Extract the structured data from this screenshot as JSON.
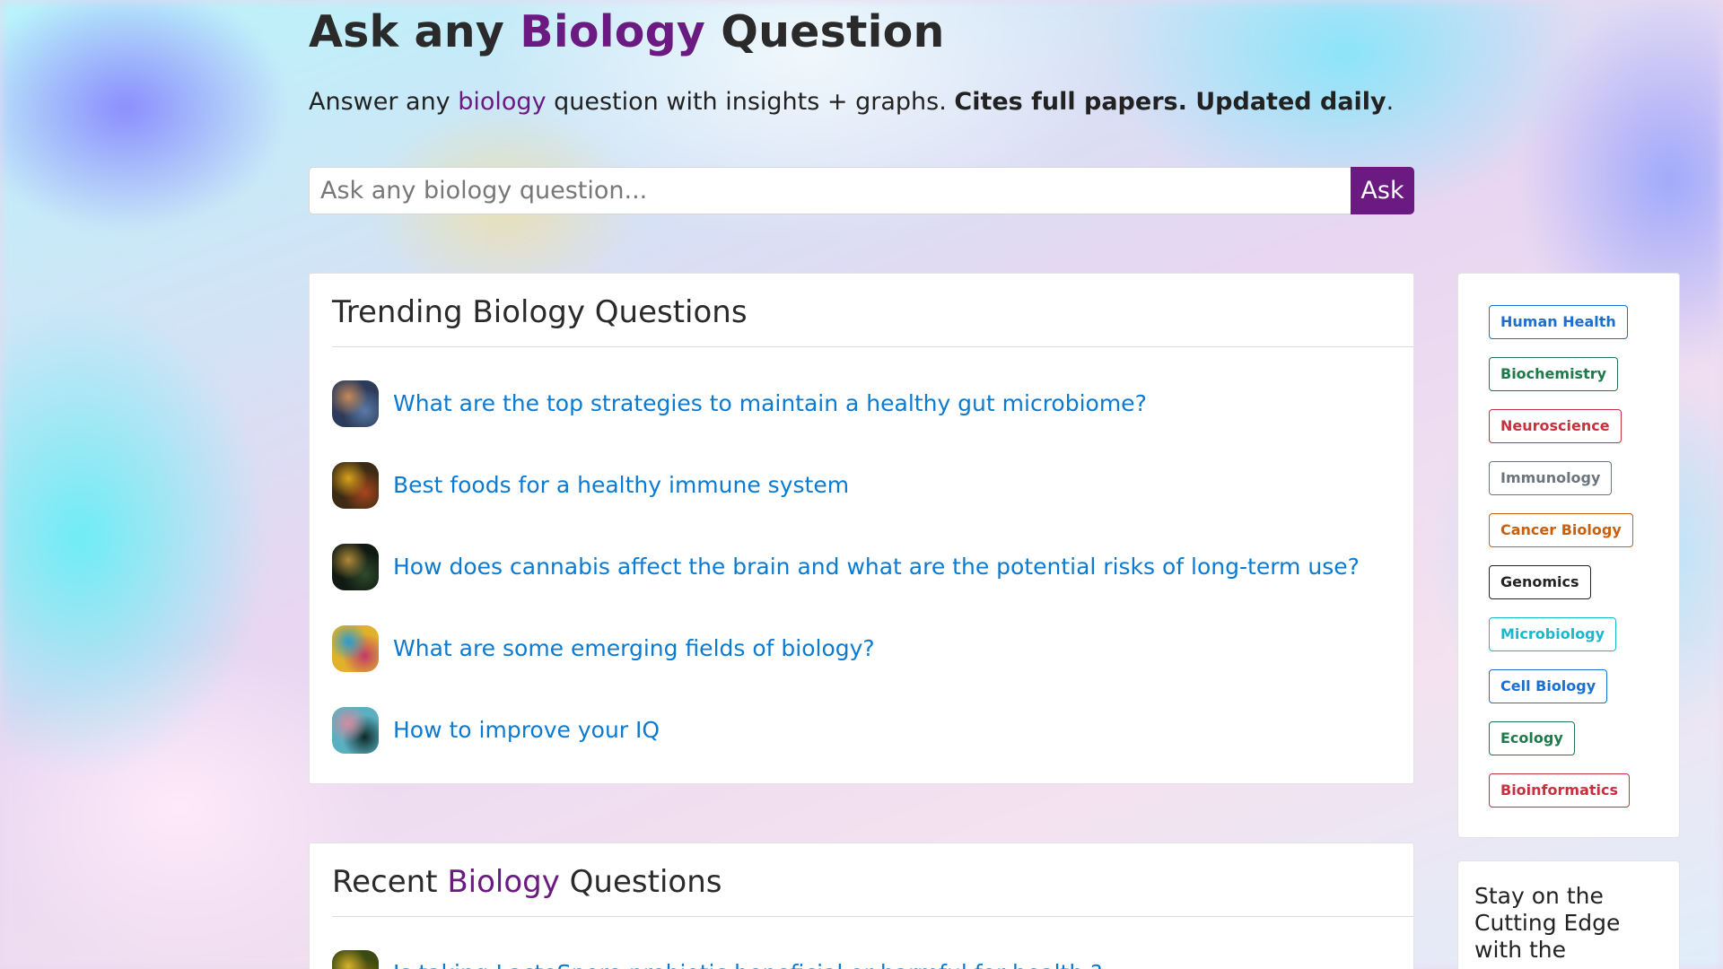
{
  "hero": {
    "title_pre": "Ask any ",
    "title_accent": "Biology",
    "title_post": " Question",
    "subtitle_pre": "Answer any ",
    "subtitle_accent": "biology",
    "subtitle_mid": " question with insights + graphs. ",
    "subtitle_bold": "Cites full papers. Updated daily",
    "subtitle_end": "."
  },
  "search": {
    "placeholder": "Ask any biology question...",
    "button_label": "Ask"
  },
  "trending": {
    "title": "Trending Biology Questions",
    "items": [
      {
        "text": "What are the top strategies to maintain a healthy gut microbiome?",
        "thumb": "gut-thumbnail",
        "colors": [
          "#5a7aa8",
          "#c58a5a",
          "#2d3b5a"
        ]
      },
      {
        "text": "Best foods for a healthy immune system",
        "thumb": "food-thumbnail",
        "colors": [
          "#a8461e",
          "#d9a21c",
          "#3b2a14"
        ]
      },
      {
        "text": "How does cannabis affect the brain and what are the potential risks of long-term use?",
        "thumb": "cannabis-brain-thumbnail",
        "colors": [
          "#2f4a2c",
          "#b08a3a",
          "#101a12"
        ]
      },
      {
        "text": "What are some emerging fields of biology?",
        "thumb": "fields-thumbnail",
        "colors": [
          "#c23a6a",
          "#2a9ad1",
          "#e1b12a"
        ]
      },
      {
        "text": "How to improve your IQ",
        "thumb": "iq-brain-thumbnail",
        "colors": [
          "#0e2a2a",
          "#d88aa0",
          "#5ab0c0"
        ]
      }
    ]
  },
  "recent": {
    "title_pre": "Recent ",
    "title_accent": "Biology",
    "title_post": " Questions",
    "items": [
      {
        "text": "Is taking LactoSpore probiotic beneficial or harmful for health ?",
        "thumb": "probiotic-thumbnail",
        "colors": [
          "#8a6a12",
          "#d9b22a",
          "#3a4a10"
        ]
      }
    ]
  },
  "tags": [
    {
      "label": "Human Health",
      "color": "#1a6fd1"
    },
    {
      "label": "Biochemistry",
      "color": "#1e7a4a"
    },
    {
      "label": "Neuroscience",
      "color": "#c9303e"
    },
    {
      "label": "Immunology",
      "color": "#6c757d"
    },
    {
      "label": "Cancer Biology",
      "color": "#c9600e"
    },
    {
      "label": "Genomics",
      "color": "#222222"
    },
    {
      "label": "Microbiology",
      "color": "#1ab8cc"
    },
    {
      "label": "Cell Biology",
      "color": "#1a6fd1"
    },
    {
      "label": "Ecology",
      "color": "#1e7a4a"
    },
    {
      "label": "Bioinformatics",
      "color": "#c9303e"
    }
  ],
  "newsletter": {
    "text": "Stay on the Cutting Edge with the"
  },
  "colors": {
    "accent": "#6b1a82",
    "link": "#0b7ad1"
  }
}
